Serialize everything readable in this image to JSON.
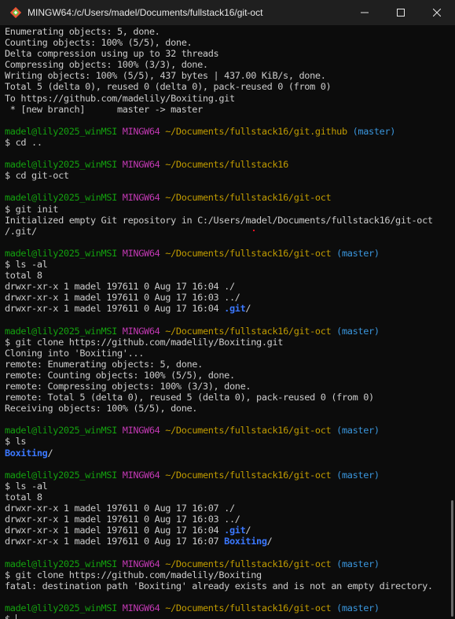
{
  "window": {
    "title": "MINGW64:/c/Users/madel/Documents/fullstack16/git-oct",
    "icons": [
      "git-bash-icon",
      "minimize-icon",
      "maximize-icon",
      "close-icon"
    ]
  },
  "prompt": {
    "user_host": "madel@lily2025_winMSI",
    "shell": "MINGW64"
  },
  "colors": {
    "background": "#0c0c0c",
    "text": "#cccccc",
    "user_host": "#13a10e",
    "shell": "#c239b3",
    "path": "#c19c00",
    "branch": "#3a96dd",
    "directory": "#3b78ff"
  },
  "terminal": {
    "lines": [
      {
        "type": "out",
        "text": "Enumerating objects: 5, done."
      },
      {
        "type": "out",
        "text": "Counting objects: 100% (5/5), done."
      },
      {
        "type": "out",
        "text": "Delta compression using up to 32 threads"
      },
      {
        "type": "out",
        "text": "Compressing objects: 100% (3/3), done."
      },
      {
        "type": "out",
        "text": "Writing objects: 100% (5/5), 437 bytes | 437.00 KiB/s, done."
      },
      {
        "type": "out",
        "text": "Total 5 (delta 0), reused 0 (delta 0), pack-reused 0 (from 0)"
      },
      {
        "type": "out",
        "text": "To https://github.com/madelily/Boxiting.git"
      },
      {
        "type": "out",
        "text": " * [new branch]      master -> master"
      },
      {
        "type": "blank"
      },
      {
        "type": "prompt",
        "path": "~/Documents/fullstack16/git.github",
        "branch": "(master)"
      },
      {
        "type": "out",
        "text": "$ cd .."
      },
      {
        "type": "blank"
      },
      {
        "type": "prompt",
        "path": "~/Documents/fullstack16",
        "branch": ""
      },
      {
        "type": "out",
        "text": "$ cd git-oct"
      },
      {
        "type": "blank"
      },
      {
        "type": "prompt",
        "path": "~/Documents/fullstack16/git-oct",
        "branch": ""
      },
      {
        "type": "out",
        "text": "$ git init"
      },
      {
        "type": "out",
        "text": "Initialized empty Git repository in C:/Users/madel/Documents/fullstack16/git-oct"
      },
      {
        "type": "out",
        "text": "/.git/"
      },
      {
        "type": "blank"
      },
      {
        "type": "prompt",
        "path": "~/Documents/fullstack16/git-oct",
        "branch": "(master)"
      },
      {
        "type": "out",
        "text": "$ ls -al"
      },
      {
        "type": "out",
        "text": "total 8"
      },
      {
        "type": "ls",
        "text": "drwxr-xr-x 1 madel 197611 0 Aug 17 16:04 ",
        "name": "./",
        "bold": false
      },
      {
        "type": "ls",
        "text": "drwxr-xr-x 1 madel 197611 0 Aug 17 16:03 ",
        "name": "../",
        "bold": false
      },
      {
        "type": "ls",
        "text": "drwxr-xr-x 1 madel 197611 0 Aug 17 16:04 ",
        "name": ".git",
        "suffix": "/",
        "bold": true
      },
      {
        "type": "blank"
      },
      {
        "type": "prompt",
        "path": "~/Documents/fullstack16/git-oct",
        "branch": "(master)"
      },
      {
        "type": "out",
        "text": "$ git clone https://github.com/madelily/Boxiting.git"
      },
      {
        "type": "out",
        "text": "Cloning into 'Boxiting'..."
      },
      {
        "type": "out",
        "text": "remote: Enumerating objects: 5, done."
      },
      {
        "type": "out",
        "text": "remote: Counting objects: 100% (5/5), done."
      },
      {
        "type": "out",
        "text": "remote: Compressing objects: 100% (3/3), done."
      },
      {
        "type": "out",
        "text": "remote: Total 5 (delta 0), reused 5 (delta 0), pack-reused 0 (from 0)"
      },
      {
        "type": "out",
        "text": "Receiving objects: 100% (5/5), done."
      },
      {
        "type": "blank"
      },
      {
        "type": "prompt",
        "path": "~/Documents/fullstack16/git-oct",
        "branch": "(master)"
      },
      {
        "type": "out",
        "text": "$ ls"
      },
      {
        "type": "ls",
        "text": "",
        "name": "Boxiting",
        "suffix": "/",
        "bold": true
      },
      {
        "type": "blank"
      },
      {
        "type": "prompt",
        "path": "~/Documents/fullstack16/git-oct",
        "branch": "(master)"
      },
      {
        "type": "out",
        "text": "$ ls -al"
      },
      {
        "type": "out",
        "text": "total 8"
      },
      {
        "type": "ls",
        "text": "drwxr-xr-x 1 madel 197611 0 Aug 17 16:07 ",
        "name": "./",
        "bold": false
      },
      {
        "type": "ls",
        "text": "drwxr-xr-x 1 madel 197611 0 Aug 17 16:03 ",
        "name": "../",
        "bold": false
      },
      {
        "type": "ls",
        "text": "drwxr-xr-x 1 madel 197611 0 Aug 17 16:04 ",
        "name": ".git",
        "suffix": "/",
        "bold": true
      },
      {
        "type": "ls",
        "text": "drwxr-xr-x 1 madel 197611 0 Aug 17 16:07 ",
        "name": "Boxiting",
        "suffix": "/",
        "bold": true
      },
      {
        "type": "blank"
      },
      {
        "type": "prompt",
        "path": "~/Documents/fullstack16/git-oct",
        "branch": "(master)"
      },
      {
        "type": "out",
        "text": "$ git clone https://github.com/madelily/Boxiting"
      },
      {
        "type": "out",
        "text": "fatal: destination path 'Boxiting' already exists and is not an empty directory."
      },
      {
        "type": "blank"
      },
      {
        "type": "prompt",
        "path": "~/Documents/fullstack16/git-oct",
        "branch": "(master)"
      },
      {
        "type": "cursor",
        "text": "$ "
      }
    ]
  }
}
